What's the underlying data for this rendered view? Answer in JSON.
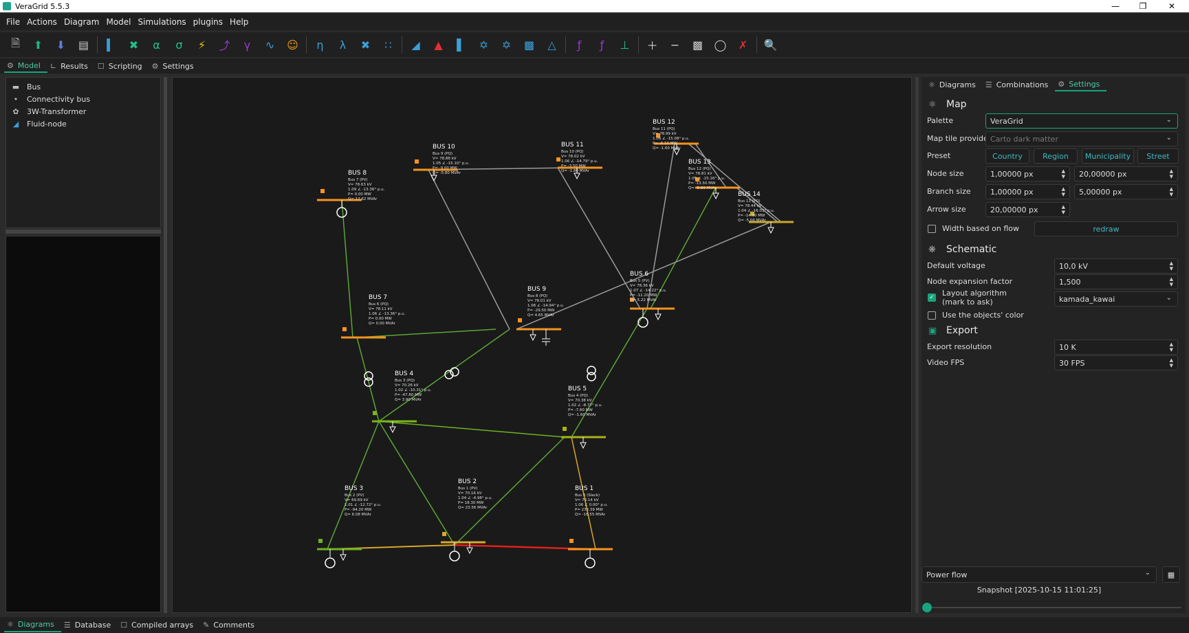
{
  "window": {
    "title": "VeraGrid 5.5.3"
  },
  "menu": [
    "File",
    "Actions",
    "Diagram",
    "Model",
    "Simulations",
    "plugins",
    "Help"
  ],
  "main_tabs": [
    {
      "label": "Model",
      "active": true,
      "icon": "model-icon"
    },
    {
      "label": "Results",
      "active": false,
      "icon": "chart-icon"
    },
    {
      "label": "Scripting",
      "active": false,
      "icon": "script-icon"
    },
    {
      "label": "Settings",
      "active": false,
      "icon": "gear-icon"
    }
  ],
  "library": [
    {
      "label": "Bus",
      "icon": "bus-icon"
    },
    {
      "label": "Connectivity bus",
      "icon": "dot-icon"
    },
    {
      "label": "3W-Transformer",
      "icon": "transformer-icon"
    },
    {
      "label": "Fluid-node",
      "icon": "fluid-icon"
    }
  ],
  "right_tabs": [
    {
      "label": "Diagrams",
      "active": false
    },
    {
      "label": "Combinations",
      "active": false
    },
    {
      "label": "Settings",
      "active": true
    }
  ],
  "settings": {
    "map": {
      "title": "Map",
      "palette_label": "Palette",
      "palette_value": "VeraGrid",
      "tile_label": "Map tile provider",
      "tile_value": "Carto dark matter",
      "preset_label": "Preset",
      "presets": [
        "Country",
        "Region",
        "Municipality",
        "Street"
      ],
      "node_size_label": "Node size",
      "node_size_1": "1,00000 px",
      "node_size_2": "20,00000 px",
      "branch_size_label": "Branch size",
      "branch_size_1": "1,00000 px",
      "branch_size_2": "5,00000 px",
      "arrow_size_label": "Arrow size",
      "arrow_size": "20,00000 px",
      "width_flow_label": "Width based on flow",
      "redraw_label": "redraw"
    },
    "schematic": {
      "title": "Schematic",
      "default_voltage_label": "Default voltage",
      "default_voltage": "10,0 kV",
      "expansion_label": "Node expansion factor",
      "expansion": "1,500",
      "layout_label_1": "Layout algorithm",
      "layout_label_2": "(mark to ask)",
      "layout_value": "kamada_kawai",
      "objects_color_label": "Use the objects' color"
    },
    "export": {
      "title": "Export",
      "resolution_label": "Export resolution",
      "resolution": "10 K",
      "fps_label": "Video FPS",
      "fps": "30 FPS"
    }
  },
  "simulation": {
    "selected": "Power flow",
    "snapshot": "Snapshot [2025-10-15 11:01:25]"
  },
  "bottom_tabs": [
    {
      "label": "Diagrams",
      "active": true
    },
    {
      "label": "Database",
      "active": false
    },
    {
      "label": "Compiled arrays",
      "active": false
    },
    {
      "label": "Comments",
      "active": false
    }
  ],
  "colors": {
    "accent": "#18a57d",
    "bus_orange": "#f7941d",
    "line_green": "#5aa636",
    "line_gray": "#9a9a9a",
    "line_red": "#e0201b",
    "line_yellow": "#d9a72a"
  },
  "diagram": {
    "buses": [
      {
        "name": "BUS 1",
        "info": [
          "Bus 0 (Slack)",
          "V= 73.14 kV",
          "1.06 ∠ 0.00° p.u.",
          "P= 232.39 MW",
          "Q= -16.55 MVAr"
        ]
      },
      {
        "name": "BUS 2",
        "info": [
          "Bus 1 (PV)",
          "V= 70.16 kV",
          "1.04 ∠ -4.98° p.u.",
          "P= 18.30 MW",
          "Q= 23.56 MVAr"
        ]
      },
      {
        "name": "BUS 3",
        "info": [
          "Bus 2 (PV)",
          "V= 69.69 kV",
          "1.01 ∠ -12.72° p.u.",
          "P= -94.20 MW",
          "Q= 6.08 MVAr"
        ]
      },
      {
        "name": "BUS 4",
        "info": [
          "Bus 3 (PQ)",
          "V= 70.26 kV",
          "1.02 ∠ -10.31° p.u.",
          "P= -47.80 MW",
          "Q= 3.90 MVAr"
        ]
      },
      {
        "name": "BUS 5",
        "info": [
          "Bus 4 (PQ)",
          "V= 70.38 kV",
          "1.02 ∠ -8.77° p.u.",
          "P= -7.60 MW",
          "Q= -1.60 MVAr"
        ]
      },
      {
        "name": "BUS 6",
        "info": [
          "Bus 5 (PV)",
          "V= 78.36 kV",
          "1.07 ∠ -14.22° p.u.",
          "P= -11.20 MW",
          "Q= 5.22 MVAr"
        ]
      },
      {
        "name": "BUS 7",
        "info": [
          "Bus 6 (PQ)",
          "V= 78.11 kV",
          "1.06 ∠ -13.36° p.u.",
          "P= 0.00 MW",
          "Q= 0.00 MVAr"
        ]
      },
      {
        "name": "BUS 8",
        "info": [
          "Bus 7 (PV)",
          "V= 78.63 kV",
          "1.09 ∠ -13.36° p.u.",
          "P= 0.00 MW",
          "Q= 17.62 MVAr"
        ]
      },
      {
        "name": "BUS 9",
        "info": [
          "Bus 8 (PQ)",
          "V= 78.01 kV",
          "1.06 ∠ -14.94° p.u.",
          "P= -29.50 MW",
          "Q= 4.65 MVAr"
        ]
      },
      {
        "name": "BUS 10",
        "info": [
          "Bus 9 (PQ)",
          "V= 78.88 kV",
          "1.05 ∠ -15.10° p.u.",
          "P= -9.00 MW",
          "Q= -5.80 MVAr"
        ]
      },
      {
        "name": "BUS 11",
        "info": [
          "Bus 10 (PQ)",
          "V= 78.02 kV",
          "1.06 ∠ -14.79° p.u.",
          "P= -3.50 MW",
          "Q= -1.80 MVAr"
        ]
      },
      {
        "name": "BUS 12",
        "info": [
          "Bus 11 (PQ)",
          "V= 78.99 kV",
          "1.06 ∠ -15.08° p.u.",
          "P= -6.10 MW",
          "Q= -1.60 MVAr"
        ]
      },
      {
        "name": "BUS 13",
        "info": [
          "Bus 12 (PQ)",
          "V= 78.81 kV",
          "1.05 ∠ -15.16° p.u.",
          "P= -13.50 MW",
          "Q= -5.80 MVAr"
        ]
      },
      {
        "name": "BUS 14",
        "info": [
          "Bus 13 (PQ)",
          "V= 78.44 kV",
          "1.04 ∠ -16.03° p.u.",
          "P= -14.90 MW",
          "Q= -5.00 MVAr"
        ]
      }
    ]
  }
}
